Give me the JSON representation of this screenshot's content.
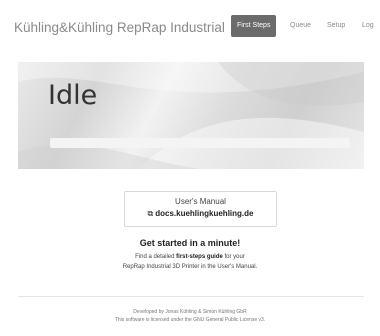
{
  "header": {
    "brand": "Kühling&Kühling RepRap Industrial",
    "nav": [
      "First Steps",
      "Queue",
      "Setup",
      "Log"
    ],
    "active": "First Steps"
  },
  "hero": {
    "status": "Idle",
    "progress": 0
  },
  "manual": {
    "title": "User's Manual",
    "link_icon": "external-link-icon",
    "link": "docs.kuehlingkuehling.de"
  },
  "getting_started": {
    "heading": "Get started in a minute!",
    "line1_pre": "Find a detailed ",
    "line1_bold": "first-steps guide",
    "line1_post": " for your",
    "line2": "RepRap Industrial 3D Printer in the User's Manual."
  },
  "footer": {
    "line1": "Developed by Jonas Kühling & Simon Kühling GbR",
    "line2": "This software is licensed under the GNU General Public License v3."
  },
  "colors": {
    "nav_active_bg": "#6b6b6b",
    "progress_fill": "#3a7bd5"
  }
}
